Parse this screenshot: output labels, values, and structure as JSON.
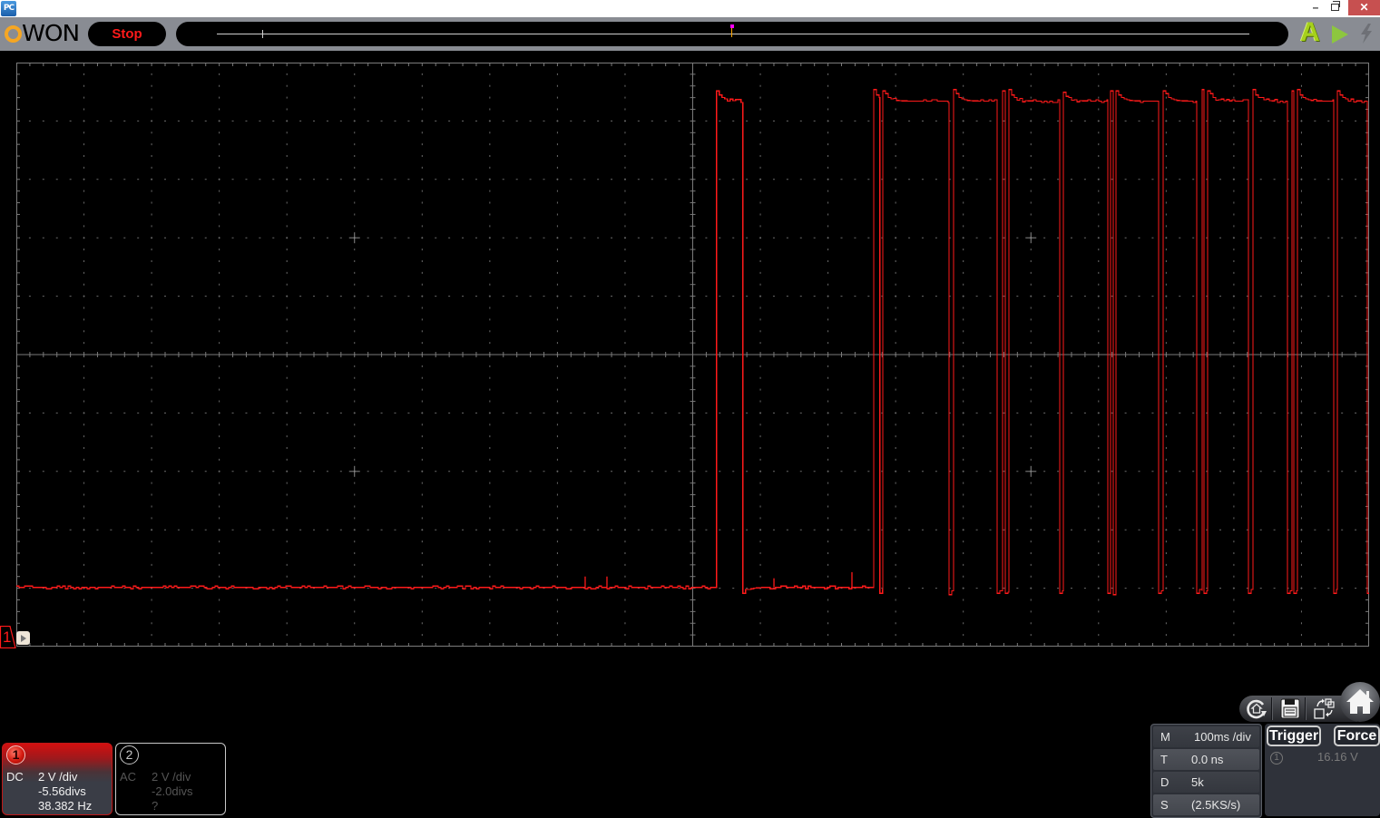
{
  "window": {
    "app_icon_label": "PC",
    "minimize_glyph": "–",
    "close_glyph": "✕"
  },
  "toolbar": {
    "logo_text": "WON",
    "brand_color": "#f5a623",
    "run_state_label": "Stop",
    "run_state_color": "#ff1a1a",
    "auto_button_glyph": "A",
    "auto_button_color": "#a6d11b",
    "run_button_color": "#8dc63f",
    "force_icon_color": "#6e7076"
  },
  "display": {
    "channel_marker_label": "1"
  },
  "channels": [
    {
      "number": "1",
      "coupling": "DC",
      "volts_per_div": "2 V /div",
      "offset": "-5.56divs",
      "frequency": "38.382 Hz",
      "active": true,
      "color": "#e01a1a"
    },
    {
      "number": "2",
      "coupling": "AC",
      "volts_per_div": "2 V /div",
      "offset": "-2.0divs",
      "frequency": "?",
      "active": false,
      "color": "#555555"
    }
  ],
  "quick_buttons": [
    "auto-setup",
    "save",
    "swap-channels",
    "home"
  ],
  "timebase": {
    "rows": [
      {
        "key": "M",
        "value": "100ms /div"
      },
      {
        "key": "T",
        "value": "0.0 ns"
      },
      {
        "key": "D",
        "value": "5k"
      },
      {
        "key": "S",
        "value": "(2.5KS/s)"
      }
    ]
  },
  "trigger": {
    "trigger_label": "Trigger",
    "force_label": "Force",
    "source": "1",
    "level": "16.16 V"
  },
  "chart_data": {
    "type": "line",
    "title": "",
    "xlabel": "",
    "ylabel": "",
    "x_unit": "ms",
    "y_unit": "V",
    "xlim": [
      -1000,
      1000
    ],
    "ylim": [
      1.12,
      21.12
    ],
    "time_per_div_ms": 100,
    "volts_per_div": 2,
    "offset_divs": -5.56,
    "x_divisions": 20,
    "y_divisions": 10,
    "trigger_time_ms": 0,
    "grid": true,
    "legend": "none",
    "series": [
      {
        "name": "CH1",
        "color": "#ff1a1a",
        "initial_state": "low",
        "low_level_v": 3.15,
        "high_level_v": 19.8,
        "overshoot_v": 0.35,
        "undershoot_v": 0.2,
        "edges_ms": [
          35.1,
          74.0,
          267.6,
          276.6,
          281.0,
          378.9,
          385.6,
          450.0,
          458.1,
          462.1,
          467.5,
          542.6,
          548.0,
          613.7,
          617.7,
          621.7,
          625.8,
          688.8,
          695.5,
          745.1,
          753.2,
          755.9,
          761.2,
          821.6,
          828.3,
          879.3,
          886.0,
          888.7,
          894.0,
          947.7,
          953.1,
          997.3
        ],
        "spikes": [
          {
            "t_ms": -159.0,
            "v": 3.52
          },
          {
            "t_ms": -126.8,
            "v": 3.52
          },
          {
            "t_ms": 120.1,
            "v": 3.46
          },
          {
            "t_ms": 235.4,
            "v": 3.67
          }
        ]
      }
    ]
  }
}
